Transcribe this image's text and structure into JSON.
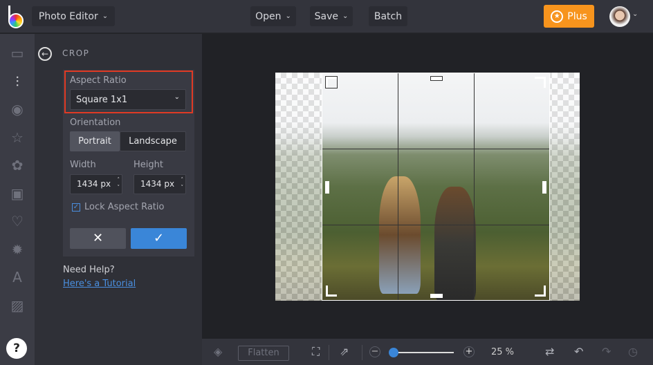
{
  "header": {
    "app_title": "Photo Editor",
    "open": "Open",
    "save": "Save",
    "batch": "Batch",
    "plus": "Plus"
  },
  "rail": {
    "items": [
      "image-icon",
      "sliders-icon",
      "eye-icon",
      "star-icon",
      "flower-icon",
      "frame-icon",
      "heart-icon",
      "badge-icon",
      "text-icon",
      "texture-icon"
    ],
    "help": "?"
  },
  "panel": {
    "title": "CROP",
    "aspect_label": "Aspect Ratio",
    "aspect_value": "Square 1x1",
    "orientation_label": "Orientation",
    "portrait": "Portrait",
    "landscape": "Landscape",
    "width_label": "Width",
    "height_label": "Height",
    "width_value": "1434",
    "height_value": "1434",
    "unit": "px",
    "lock_label": "Lock Aspect Ratio",
    "lock_checked": true,
    "help_title": "Need Help?",
    "help_link": "Here's a Tutorial"
  },
  "bottom": {
    "flatten": "Flatten",
    "zoom": "25 %",
    "zoom_fraction": 0.05
  },
  "colors": {
    "accent": "#f7941d",
    "primary": "#3a86d8",
    "highlight": "#e03a24"
  }
}
